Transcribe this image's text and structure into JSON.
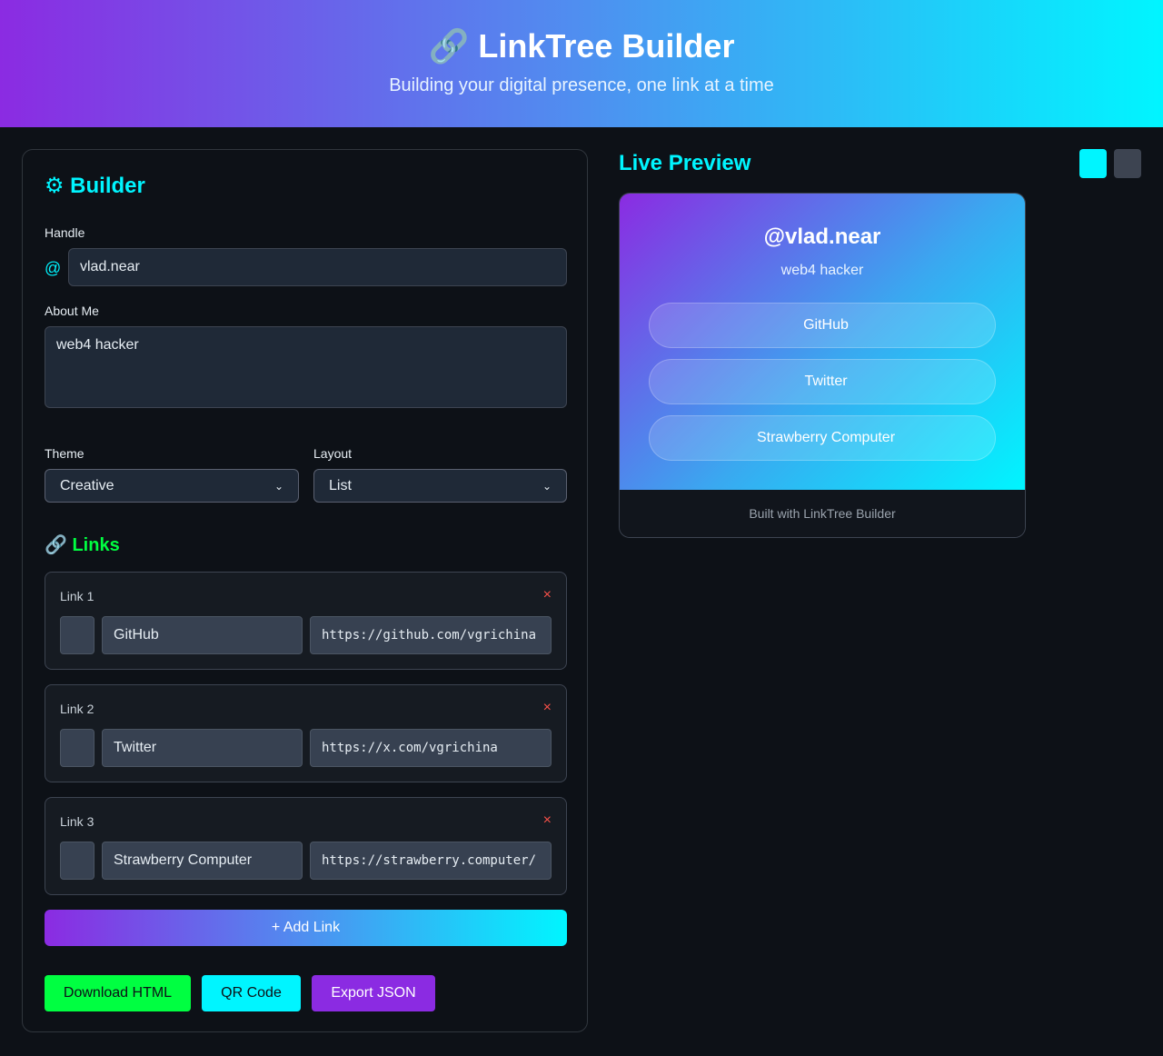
{
  "header": {
    "title": "🔗 LinkTree Builder",
    "subtitle": "Building your digital presence, one link at a time"
  },
  "builder": {
    "title": "⚙ Builder",
    "handle_label": "Handle",
    "handle_prefix": "@",
    "handle_value": "vlad.near",
    "about_label": "About Me",
    "about_value": "web4 hacker",
    "theme_label": "Theme",
    "theme_value": "Creative",
    "layout_label": "Layout",
    "layout_value": "List",
    "links_title": "🔗 Links",
    "links": [
      {
        "label": "Link 1",
        "icon": "",
        "title": "GitHub",
        "url": "https://github.com/vgrichina"
      },
      {
        "label": "Link 2",
        "icon": "",
        "title": "Twitter",
        "url": "https://x.com/vgrichina"
      },
      {
        "label": "Link 3",
        "icon": "",
        "title": "Strawberry Computer",
        "url": "https://strawberry.computer/"
      }
    ],
    "remove_glyph": "×",
    "add_link_label": "+ Add Link",
    "download_html_label": " Download HTML",
    "qr_code_label": " QR Code",
    "export_json_label": " Export JSON"
  },
  "preview": {
    "title": " Live Preview",
    "tool_btn_1": "",
    "tool_btn_2": "",
    "handle": "@vlad.near",
    "bio": "web4 hacker",
    "links": [
      {
        "icon": "",
        "title": "GitHub"
      },
      {
        "icon": "",
        "title": "Twitter"
      },
      {
        "icon": "",
        "title": "Strawberry Computer"
      }
    ],
    "footer": "Built with LinkTree Builder"
  },
  "colors": {
    "accent_cyan": "#00f5ff",
    "accent_green": "#00ff41",
    "accent_purple": "#8b2be2",
    "danger": "#f85149"
  }
}
